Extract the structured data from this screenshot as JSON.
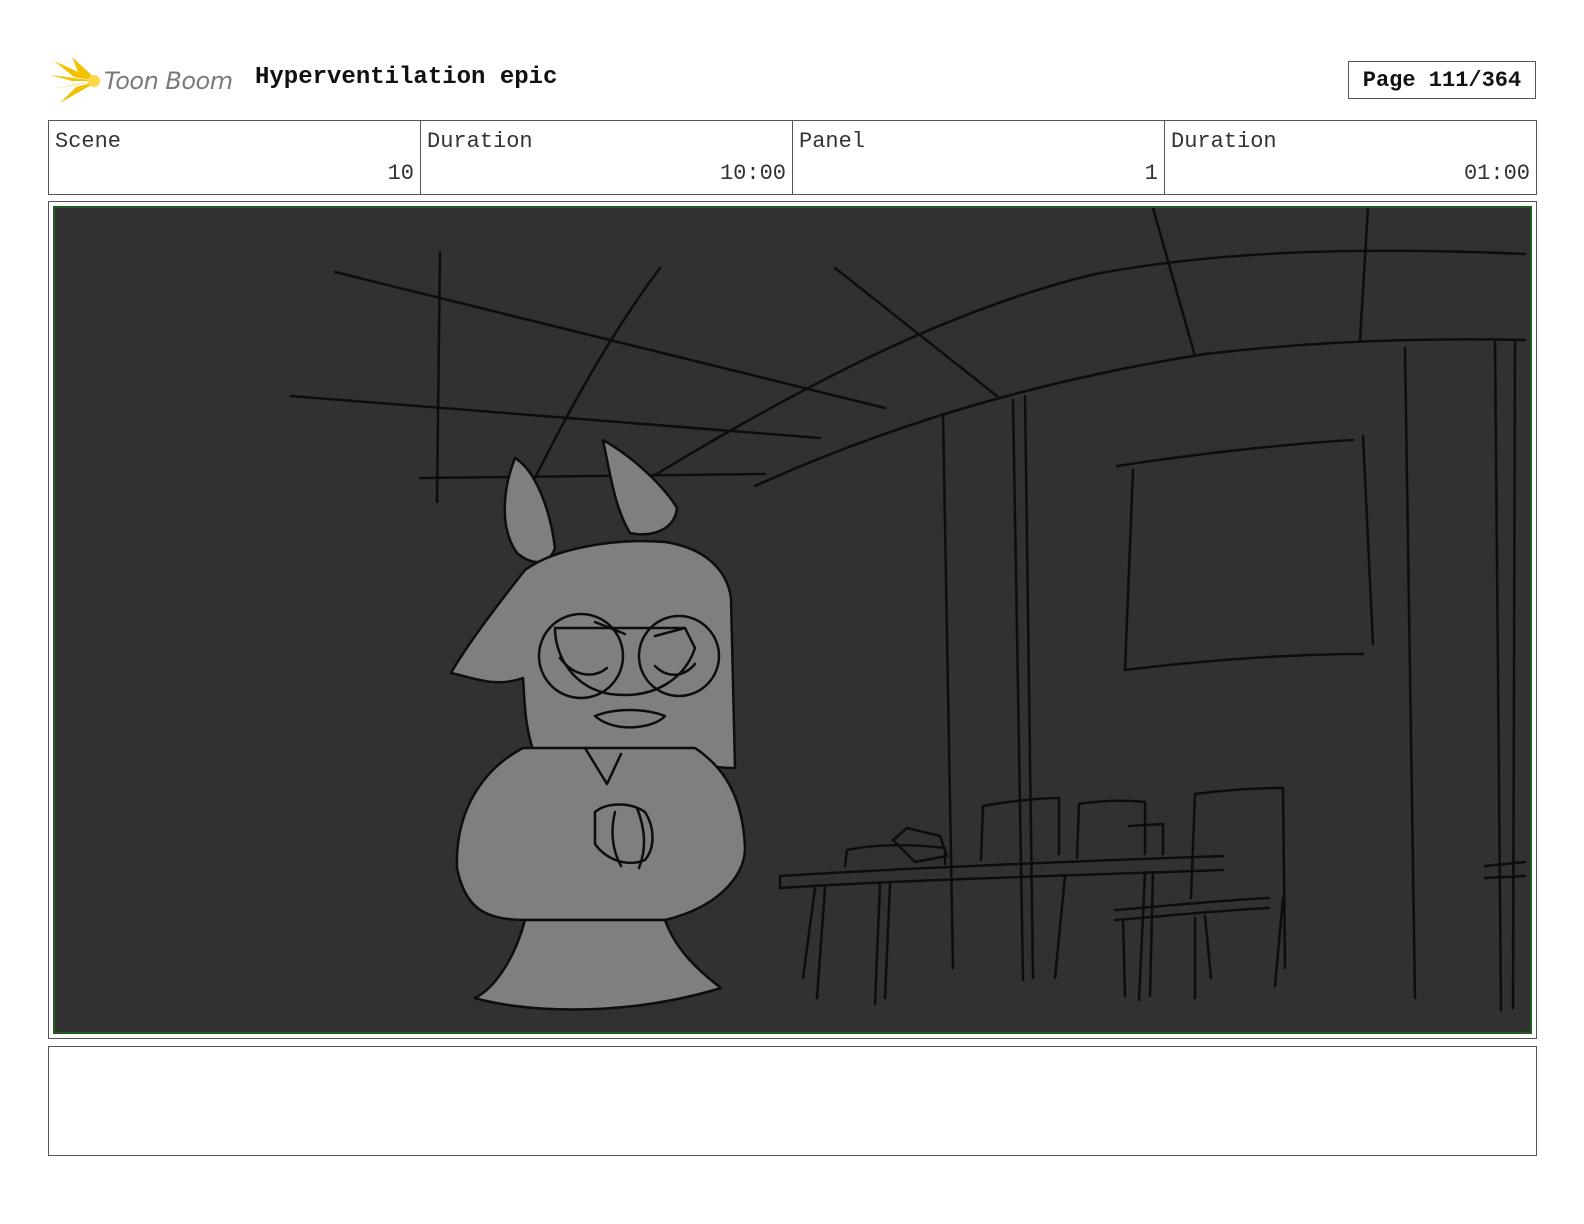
{
  "header": {
    "logo_text": "Toon Boom",
    "project_title": "Hyperventilation epic",
    "page_label": "Page 111/364"
  },
  "info": {
    "scene_label": "Scene",
    "scene_value": "10",
    "scene_duration_label": "Duration",
    "scene_duration_value": "10:00",
    "panel_label": "Panel",
    "panel_value": "1",
    "panel_duration_label": "Duration",
    "panel_duration_value": "01:00"
  },
  "notes": {
    "text": ""
  },
  "colors": {
    "panel_background": "#313131",
    "panel_border": "#1f5e1f",
    "character_fill": "#7f7f7f",
    "logo_flare": "#f2c200"
  },
  "icons": [
    "toon-boom-logo-icon"
  ]
}
